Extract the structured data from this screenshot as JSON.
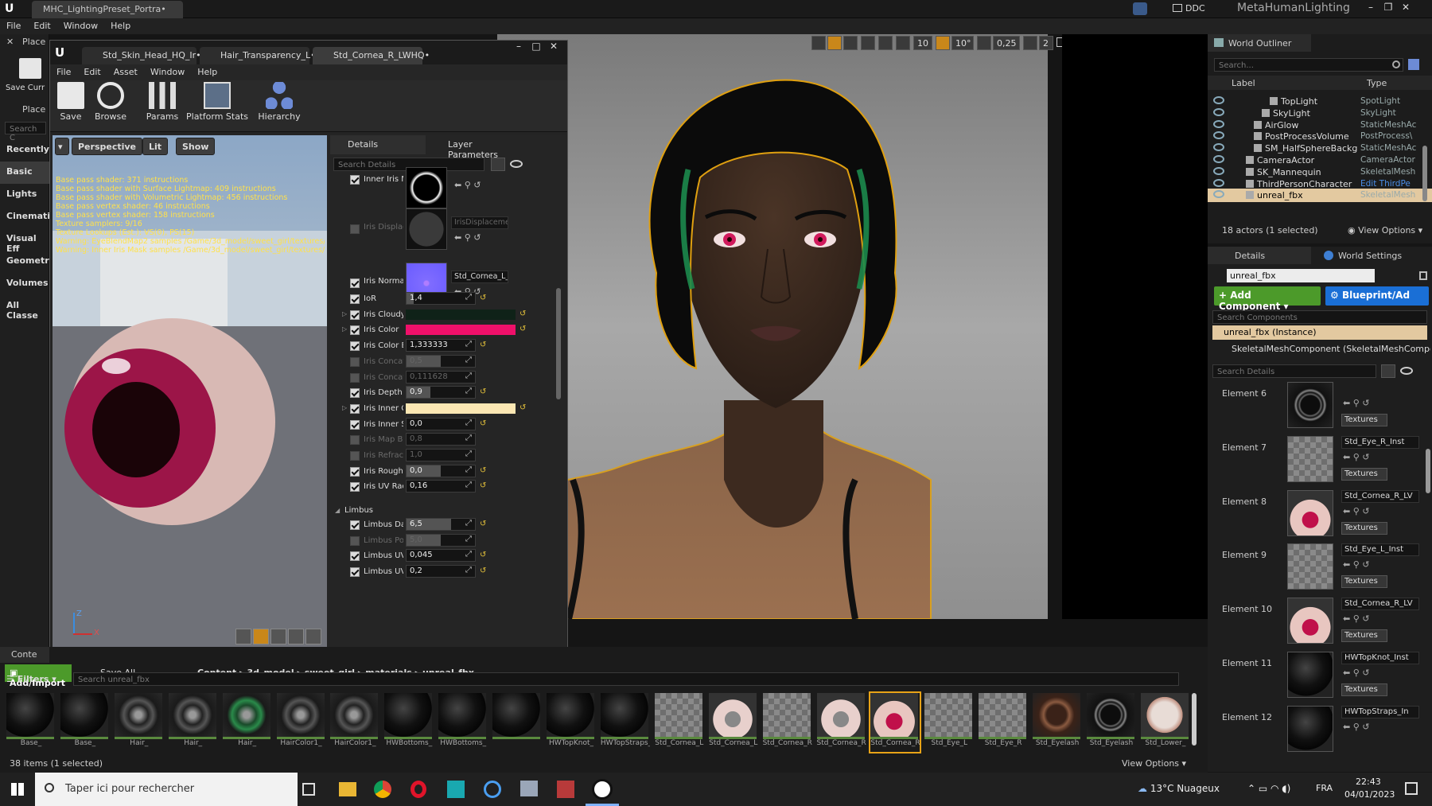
{
  "window": {
    "tab": "MHC_LightingPreset_Portra•",
    "ddc": "DDC",
    "project": "MetaHumanLighting"
  },
  "menu": [
    "File",
    "Edit",
    "Window",
    "Help"
  ],
  "left_panel": {
    "title": "Place",
    "save": "Save Curr",
    "search": "Search C",
    "categories": [
      "Recently",
      "Basic",
      "Lights",
      "Cinemati",
      "Visual Eff",
      "Geometry",
      "Volumes",
      "All Classe"
    ]
  },
  "material_editor": {
    "tabs": [
      "Std_Skin_Head_HQ_Ir•",
      "Hair_Transparency_L•",
      "Std_Cornea_R_LWHQ•"
    ],
    "menu": [
      "File",
      "Edit",
      "Asset",
      "Window",
      "Help"
    ],
    "toolbar": [
      "Save",
      "Browse",
      "Params",
      "Platform Stats",
      "Hierarchy"
    ],
    "viewport_buttons": {
      "perspective": "Perspective",
      "lit": "Lit",
      "show": "Show"
    },
    "stats": [
      "Base pass shader: 371 instructions",
      "Base pass shader with Surface Lightmap: 409 instructions",
      "Base pass shader with Volumetric Lightmap: 456 instructions",
      "Base pass vertex shader: 46 instructions",
      "Base pass vertex shader: 158 instructions",
      "Texture samplers: 9/16",
      "Texture Lookups (Est.): VS(0), PS(15)",
      "Warning: EyeBlendMap2 samples /Game/3d_model/sweet_girl/textures/u",
      "Warning: Inner Iris Mask samples /Game/3d_model/sweet_girl/textures/u"
    ],
    "axis": {
      "z": "Z",
      "x": "X"
    },
    "details": {
      "tab": "Details",
      "layer_tab": "Layer Parameters",
      "search": "Search Details",
      "tex_params": [
        {
          "label": "Inner Iris M",
          "enabled": true,
          "asset": ""
        },
        {
          "label": "Iris Displac",
          "enabled": false,
          "asset": "IrisDisplaceme"
        },
        {
          "label": "Iris Normal",
          "enabled": true,
          "asset": "Std_Cornea_L_I"
        }
      ],
      "params": [
        {
          "label": "IoR",
          "enabled": true,
          "value": "1,4",
          "fill": 0.1
        },
        {
          "label": "Iris Cloudy",
          "enabled": true,
          "color": "#0f2218",
          "expander": true
        },
        {
          "label": "Iris Color",
          "enabled": true,
          "color": "#f0106a",
          "expander": true
        },
        {
          "label": "Iris Color Br",
          "enabled": true,
          "value": "1,333333",
          "fill": 0.0
        },
        {
          "label": "Iris Concavi",
          "enabled": false,
          "value": "0,5",
          "fill": 0.5
        },
        {
          "label": "Iris Concavi",
          "enabled": false,
          "value": "0,111628",
          "fill": 0.0
        },
        {
          "label": "Iris Depth S",
          "enabled": true,
          "value": "0,9",
          "fill": 0.35
        },
        {
          "label": "Iris Inner Co",
          "enabled": true,
          "color": "#fbe7b3",
          "expander": true
        },
        {
          "label": "Iris Inner Sc",
          "enabled": true,
          "value": "0,0",
          "fill": 0.0
        },
        {
          "label": "Iris Map Bri",
          "enabled": false,
          "value": "0,8",
          "fill": 0.0
        },
        {
          "label": "Iris Refracti",
          "enabled": false,
          "value": "1,0",
          "fill": 0.0
        },
        {
          "label": "Iris Roughne",
          "enabled": true,
          "value": "0,0",
          "fill": 0.5
        },
        {
          "label": "Iris UV Radi",
          "enabled": true,
          "value": "0,16",
          "fill": 0.0
        }
      ],
      "limbus_group": "Limbus",
      "limbus_params": [
        {
          "label": "Limbus Dar",
          "enabled": true,
          "value": "6,5",
          "fill": 0.65
        },
        {
          "label": "Limbus Pov",
          "enabled": false,
          "value": "5,0",
          "fill": 0.5
        },
        {
          "label": "Limbus UV",
          "enabled": true,
          "value": "0,045",
          "fill": 0.0
        },
        {
          "label": "Limbus UV",
          "enabled": true,
          "value": "0,2",
          "fill": 0.0
        }
      ]
    }
  },
  "viewport_toolbar": {
    "grid": "10",
    "angle": "10°",
    "scale": "0,25",
    "cam": "2"
  },
  "outliner": {
    "title": "World Outliner",
    "search": "Search...",
    "col_label": "Label",
    "col_type": "Type",
    "rows": [
      {
        "label": "TopLight",
        "type": "SpotLight",
        "indent": 92
      },
      {
        "label": "SkyLight",
        "type": "SkyLight",
        "indent": 82
      },
      {
        "label": "AirGlow",
        "type": "StaticMeshAc",
        "indent": 72
      },
      {
        "label": "PostProcessVolume",
        "type": "PostProcess\\",
        "indent": 72
      },
      {
        "label": "SM_HalfSphereBackg",
        "type": "StaticMeshAc",
        "indent": 72
      },
      {
        "label": "CameraActor",
        "type": "CameraActor",
        "indent": 62
      },
      {
        "label": "SK_Mannequin",
        "type": "SkeletalMesh",
        "indent": 62
      },
      {
        "label": "ThirdPersonCharacter",
        "type": "Edit ThirdPe",
        "indent": 62
      },
      {
        "label": "unreal_fbx",
        "type": "SkeletalMesh",
        "indent": 62,
        "selected": true
      }
    ],
    "status": "18 actors (1 selected)",
    "view_options": "View Options"
  },
  "actor_details": {
    "tab": "Details",
    "world_settings": "World Settings",
    "name": "unreal_fbx",
    "add_component": "Add Component",
    "blueprint": "Blueprint/Ad",
    "search_components": "Search Components",
    "instance": "unreal_fbx (Instance)",
    "component": "SkeletalMeshComponent (SkeletalMeshCompo",
    "search_details": "Search Details",
    "elements": [
      {
        "label": "Element 6",
        "material": "",
        "tex": "Textures",
        "kind": "lashes"
      },
      {
        "label": "Element 7",
        "material": "Std_Eye_R_Inst",
        "tex": "Textures",
        "kind": "checker"
      },
      {
        "label": "Element 8",
        "material": "Std_Cornea_R_LV",
        "tex": "Textures",
        "kind": "eye"
      },
      {
        "label": "Element 9",
        "material": "Std_Eye_L_Inst",
        "tex": "Textures",
        "kind": "checker"
      },
      {
        "label": "Element 10",
        "material": "Std_Cornea_R_LV",
        "tex": "Textures",
        "kind": "eye"
      },
      {
        "label": "Element 11",
        "material": "HWTopKnot_Inst",
        "tex": "Textures",
        "kind": "black"
      },
      {
        "label": "Element 12",
        "material": "HWTopStraps_In",
        "tex": "",
        "kind": "black"
      }
    ]
  },
  "content_browser": {
    "title": "Conte",
    "add_import": "Add/Import",
    "save_all": "Save All",
    "path": [
      "Content",
      "3d_model",
      "sweet_girl",
      "materials",
      "unreal_fbx"
    ],
    "filters": "Filters",
    "search": "Search unreal_fbx",
    "assets": [
      {
        "name": "Base_",
        "kind": "black"
      },
      {
        "name": "Base_",
        "kind": "black"
      },
      {
        "name": "Hair_",
        "kind": "hair"
      },
      {
        "name": "Hair_",
        "kind": "hair"
      },
      {
        "name": "Hair_",
        "kind": "hairgreen"
      },
      {
        "name": "HairColor1_",
        "kind": "hair"
      },
      {
        "name": "HairColor1_",
        "kind": "hair"
      },
      {
        "name": "HWBottoms_",
        "kind": "black"
      },
      {
        "name": "HWBottoms_",
        "kind": "black"
      },
      {
        "name": "",
        "kind": "black"
      },
      {
        "name": "HWTopKnot_",
        "kind": "black"
      },
      {
        "name": "HWTopStraps_",
        "kind": "black"
      },
      {
        "name": "Std_Cornea_L",
        "kind": "checker"
      },
      {
        "name": "Std_Cornea_L",
        "kind": "eyeclear"
      },
      {
        "name": "Std_Cornea_R",
        "kind": "checker"
      },
      {
        "name": "Std_Cornea_R",
        "kind": "eyeclear"
      },
      {
        "name": "Std_Cornea_R",
        "kind": "eye"
      },
      {
        "name": "Std_Eye_L",
        "kind": "checker"
      },
      {
        "name": "Std_Eye_R",
        "kind": "checker"
      },
      {
        "name": "Std_Eyelash",
        "kind": "lashbrown"
      },
      {
        "name": "Std_Eyelash",
        "kind": "lashes"
      },
      {
        "name": "Std_Lower_",
        "kind": "skin"
      }
    ],
    "status": "38 items (1 selected)",
    "view_options": "View Options"
  },
  "taskbar": {
    "search": "Taper ici pour rechercher",
    "weather": "13°C  Nuageux",
    "lang": "FRA",
    "time": "22:43",
    "date": "04/01/2023"
  },
  "colors": {
    "accent": "#e8a317",
    "green": "#4c9a2a",
    "blue": "#1a6fd6"
  }
}
